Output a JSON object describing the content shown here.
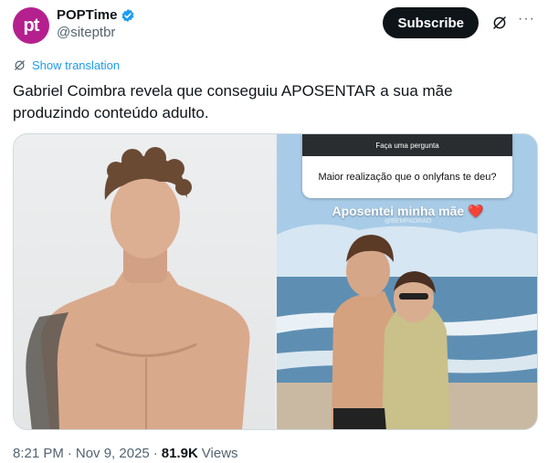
{
  "author": {
    "avatar_text": "pt",
    "display_name": "POPTime",
    "handle": "@siteptbr"
  },
  "actions": {
    "subscribe_label": "Subscribe",
    "more_label": "···"
  },
  "translate_label": "Show translation",
  "tweet_text": "Gabriel Coimbra revela que conseguiu APOSENTAR a sua mãe produzindo conteúdo adulto.",
  "media": {
    "story": {
      "question_header": "Faça uma pergunta",
      "question": "Maior realização que o onlyfans te deu?",
      "answer": "Aposentei minha mãe ❤️",
      "watermark": "@BEMPADRAO"
    }
  },
  "footer": {
    "time": "8:21 PM",
    "separator": "·",
    "date": "Nov 9, 2025",
    "separator2": "·",
    "views_count": "81.9K",
    "views_label": "Views"
  },
  "colors": {
    "accent": "#1d9bf0",
    "avatar_bg": "#b5208f",
    "text_primary": "#0f1419",
    "text_secondary": "#536471"
  }
}
